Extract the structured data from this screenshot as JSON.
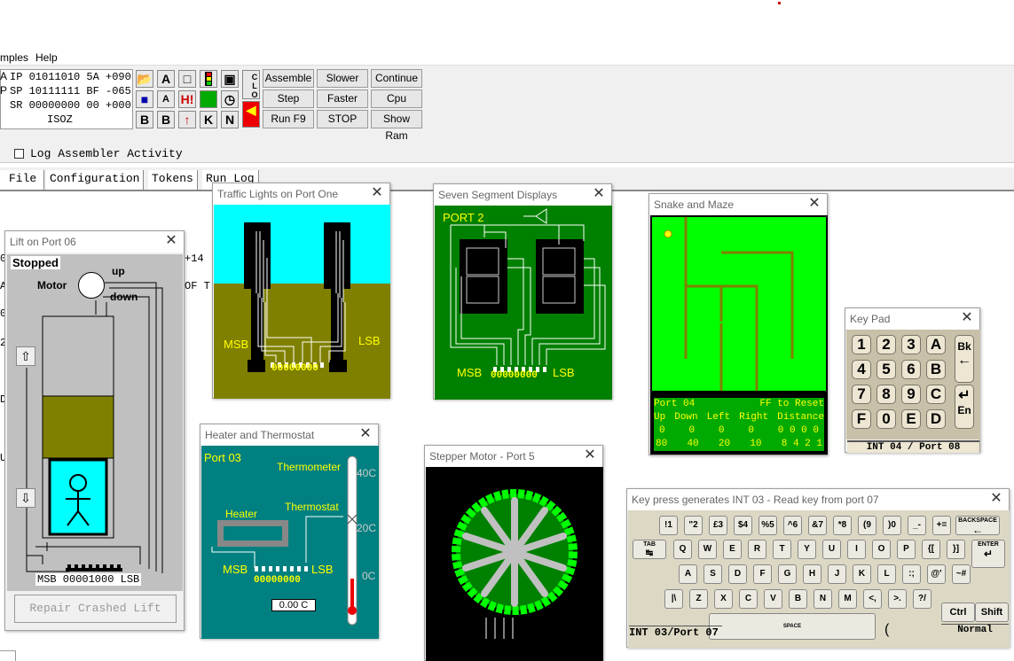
{
  "menu": {
    "items": [
      "mples",
      "Help"
    ]
  },
  "registers": {
    "rows": [
      {
        "p": "A",
        "name": "IP",
        "bin": "01011010",
        "hex": "5A",
        "dec": "+090"
      },
      {
        "p": "P",
        "name": "SP",
        "bin": "10111111",
        "hex": "BF",
        "dec": "-065"
      },
      {
        "p": "",
        "name": "SR",
        "bin": "00000000",
        "hex": "00",
        "dec": "+000"
      }
    ],
    "flags": "ISOZ"
  },
  "tool_icons": [
    "folder-open",
    "A",
    "monitor",
    "traffic-light",
    "device",
    "save",
    "small-a",
    "H!",
    "green-chip",
    "clock",
    "B",
    "B",
    "up-arrow",
    "K",
    "N",
    "speaker"
  ],
  "clo_label": "CLO",
  "controls": {
    "assemble": "Assemble",
    "slower": "Slower",
    "continue": "Continue",
    "step": "Step",
    "faster": "Faster",
    "cpu_reset": "Cpu Reset",
    "run": "Run F9",
    "stop": "STOP",
    "show_ram": "Show Ram"
  },
  "log_checkbox": "Log Assembler Activity",
  "tabs": [
    "File",
    "Configuration",
    "Tokens",
    "Run Log"
  ],
  "editor_fragments": [
    "0",
    "A",
    "0",
    "2",
    "D",
    "U",
    "+14",
    "OF T"
  ],
  "lift": {
    "title": "Lift on Port 06",
    "status": "Stopped",
    "motor": "Motor",
    "up": "up",
    "down": "down",
    "port_label": "MSB 00001000 LSB",
    "repair": "Repair Crashed Lift"
  },
  "traffic": {
    "title": "Traffic Lights on Port One",
    "msb": "MSB",
    "lsb": "LSB",
    "bits": "00000000"
  },
  "seven_seg": {
    "title": "Seven Segment Displays",
    "port": "PORT 2",
    "msb": "MSB",
    "lsb": "LSB",
    "bits": "00000000"
  },
  "snake": {
    "title": "Snake and Maze",
    "port": "Port 04",
    "reset": "FF to Reset",
    "headers": [
      "Up",
      "Down",
      "Left",
      "Right",
      "Distance"
    ],
    "row1": [
      "0",
      "0",
      "0",
      "0",
      "0 0 0 0"
    ],
    "row2": [
      "80",
      "40",
      "20",
      "10",
      "8 4 2 1"
    ]
  },
  "keypad": {
    "title": "Key Pad",
    "keys": [
      "1",
      "2",
      "3",
      "A",
      "4",
      "5",
      "6",
      "B",
      "7",
      "8",
      "9",
      "C",
      "F",
      "0",
      "E",
      "D"
    ],
    "side": [
      "Bk",
      "←",
      "↵",
      "En"
    ],
    "footer": "INT 04 / Port 08"
  },
  "heater": {
    "title": "Heater and Thermostat",
    "port": "Port 03",
    "thermometer": "Thermometer",
    "thermostat": "Thermostat",
    "heater": "Heater",
    "msb": "MSB",
    "lsb": "LSB",
    "bits": "00000000",
    "temp": "0.00 C",
    "ticks": [
      "40C",
      "20C",
      "0C"
    ]
  },
  "stepper": {
    "title": "Stepper Motor - Port 5"
  },
  "keyboard": {
    "title": "Key press generates INT 03 - Read key from port 07",
    "row1": [
      "!1",
      "\"2",
      "£3",
      "$4",
      "%5",
      "^6",
      "&7",
      "*8",
      "(9",
      ")0",
      "_-",
      "+="
    ],
    "backspace": "BACKSPACE",
    "tab": "TAB",
    "row2": [
      "Q",
      "W",
      "E",
      "R",
      "T",
      "Y",
      "U",
      "I",
      "O",
      "P",
      "{[",
      "}]"
    ],
    "enter": "ENTER",
    "row3": [
      "A",
      "S",
      "D",
      "F",
      "G",
      "H",
      "J",
      "K",
      "L",
      ":;",
      "@'",
      "~#"
    ],
    "row4": [
      "|\\",
      "Z",
      "X",
      "C",
      "V",
      "B",
      "N",
      "M",
      "<,",
      ">.",
      "?/"
    ],
    "space": "SPACE",
    "ctrl": "Ctrl",
    "shift": "Shift",
    "normal": "Normal",
    "footer": "INT 03/Port 07",
    "paren": "("
  },
  "colors": {
    "green_panel": "#008000",
    "teal_panel": "#008080",
    "olive": "#808000",
    "snake_green": "#00ff00",
    "lift_cyan": "#00ffff"
  }
}
